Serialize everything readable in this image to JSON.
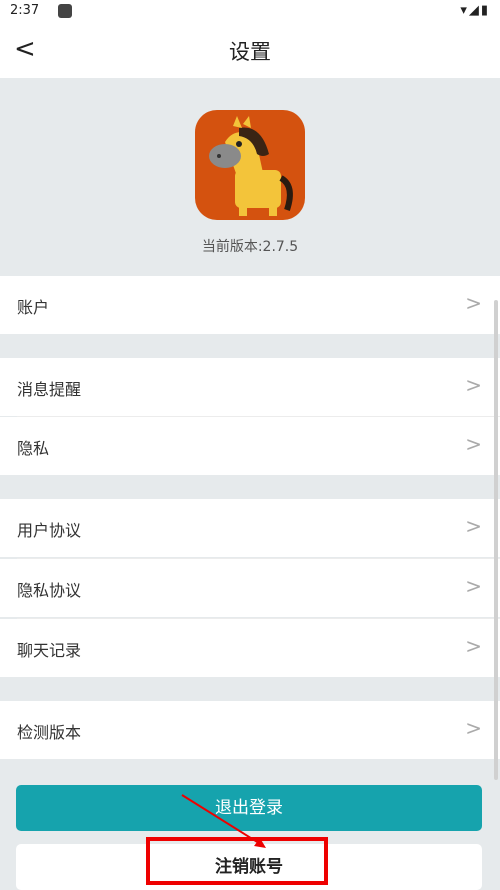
{
  "statusbar": {
    "time": "2:37",
    "signal": "▾◢▮"
  },
  "header": {
    "back_glyph": "<",
    "title": "设置"
  },
  "app": {
    "version_text": "当前版本:2.7.5",
    "logo_bg": "#d4520f"
  },
  "menu": {
    "account": "账户",
    "notifications": "消息提醒",
    "privacy": "隐私",
    "user_agreement": "用户协议",
    "privacy_agreement": "隐私协议",
    "chat_history": "聊天记录",
    "check_version": "检测版本",
    "chevron": ">"
  },
  "buttons": {
    "logout": "退出登录",
    "delete_account": "注销账号"
  },
  "colors": {
    "accent": "#16a3ad",
    "highlight": "#ee0000"
  }
}
